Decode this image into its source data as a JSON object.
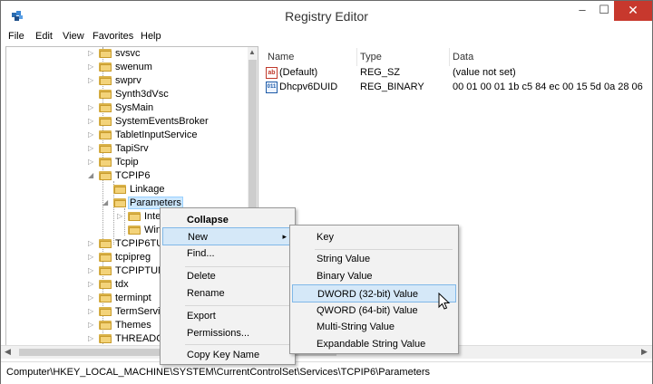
{
  "window": {
    "title": "Registry Editor",
    "min": "–",
    "max": "☐",
    "close": "✕",
    "icon": "registry-editor-icon"
  },
  "menu": [
    "File",
    "Edit",
    "View",
    "Favorites",
    "Help"
  ],
  "tree": {
    "nodes": [
      {
        "label": "svsvc"
      },
      {
        "label": "swenum"
      },
      {
        "label": "swprv"
      },
      {
        "label": "Synth3dVsc"
      },
      {
        "label": "SysMain"
      },
      {
        "label": "SystemEventsBroker"
      },
      {
        "label": "TabletInputService"
      },
      {
        "label": "TapiSrv"
      },
      {
        "label": "Tcpip"
      },
      {
        "label": "TCPIP6"
      },
      {
        "label": "Linkage"
      },
      {
        "label": "Parameters"
      },
      {
        "label": "Inte"
      },
      {
        "label": "Win"
      },
      {
        "label": "TCPIP6TUN"
      },
      {
        "label": "tcpipreg"
      },
      {
        "label": "TCPIPTUN"
      },
      {
        "label": "tdx"
      },
      {
        "label": "terminpt"
      },
      {
        "label": "TermServic"
      },
      {
        "label": "Themes"
      },
      {
        "label": "THREADOR"
      }
    ]
  },
  "list": {
    "columns": [
      "Name",
      "Type",
      "Data"
    ],
    "rows": [
      {
        "icon": "string-value-icon",
        "icon_text": "ab",
        "name": "(Default)",
        "type": "REG_SZ",
        "data": "(value not set)"
      },
      {
        "icon": "binary-value-icon",
        "icon_text": "011",
        "name": "Dhcpv6DUID",
        "type": "REG_BINARY",
        "data": "00 01 00 01 1b c5 84 ec 00 15 5d 0a 28 06"
      }
    ]
  },
  "context_menu": {
    "items": [
      "Collapse",
      "New",
      "Find...",
      "Delete",
      "Rename",
      "Export",
      "Permissions...",
      "Copy Key Name"
    ],
    "submenu_arrow": "▸"
  },
  "new_submenu": {
    "items": [
      "Key",
      "String Value",
      "Binary Value",
      "DWORD (32-bit) Value",
      "QWORD (64-bit) Value",
      "Multi-String Value",
      "Expandable String Value"
    ]
  },
  "statusbar": {
    "path": "Computer\\HKEY_LOCAL_MACHINE\\SYSTEM\\CurrentControlSet\\Services\\TCPIP6\\Parameters"
  },
  "scroll": {
    "up": "▲",
    "left": "◀",
    "right": "▶"
  },
  "colors": {
    "selection": "#cde8ff",
    "menu_highlight": "#d5e8f8",
    "close_button": "#c7382d",
    "folder": "#f3d37a"
  }
}
